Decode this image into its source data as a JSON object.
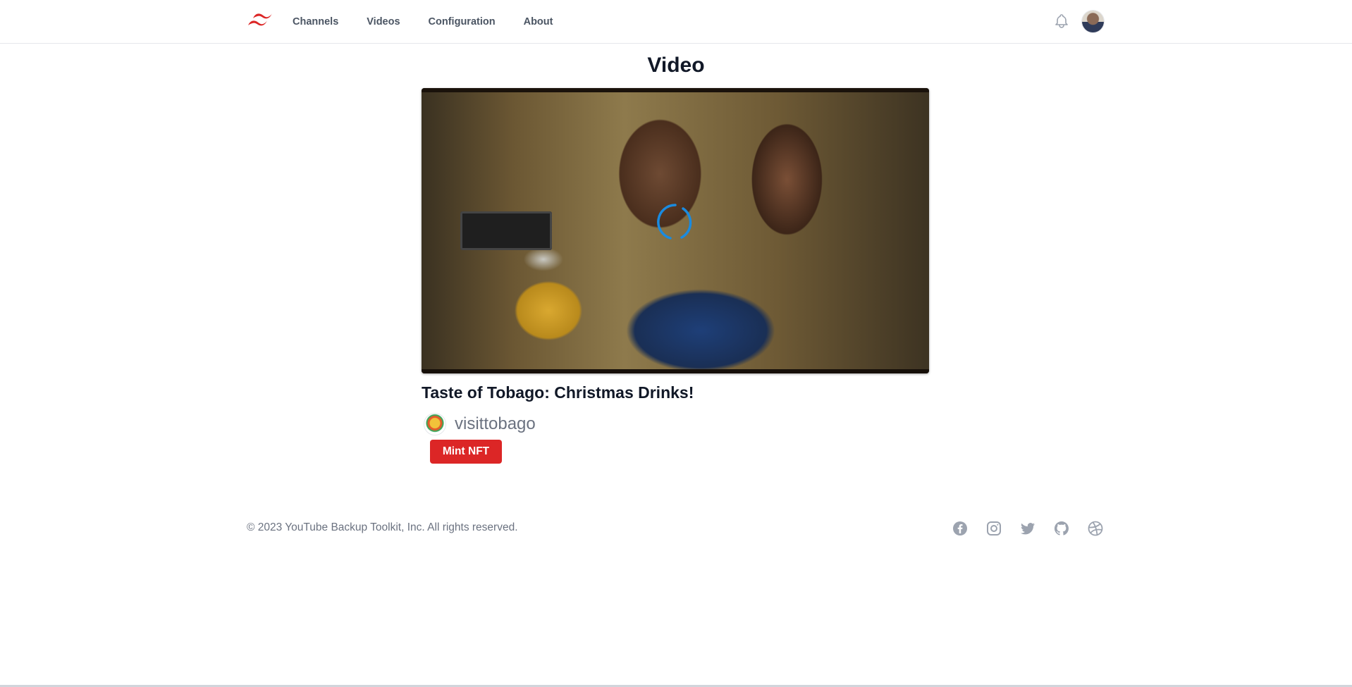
{
  "nav": {
    "items": [
      {
        "label": "Channels"
      },
      {
        "label": "Videos"
      },
      {
        "label": "Configuration"
      },
      {
        "label": "About"
      }
    ]
  },
  "header": {
    "logo_icon": "tailwind-logo-icon",
    "notification_icon": "bell-icon",
    "user_avatar": "avatar"
  },
  "main": {
    "page_title": "Video",
    "video_title": "Taste of Tobago: Christmas Drinks!",
    "channel_name": "visittobago",
    "mint_button_label": "Mint NFT",
    "player_state_icon": "loading-spinner-icon"
  },
  "footer": {
    "copyright": "© 2023 YouTube Backup Toolkit, Inc. All rights reserved.",
    "social_icons": [
      "facebook-icon",
      "instagram-icon",
      "twitter-icon",
      "github-icon",
      "dribbble-icon"
    ]
  },
  "colors": {
    "accent_red": "#dc2626",
    "spinner_blue": "#1a8be0",
    "text_muted": "#6b7280"
  }
}
